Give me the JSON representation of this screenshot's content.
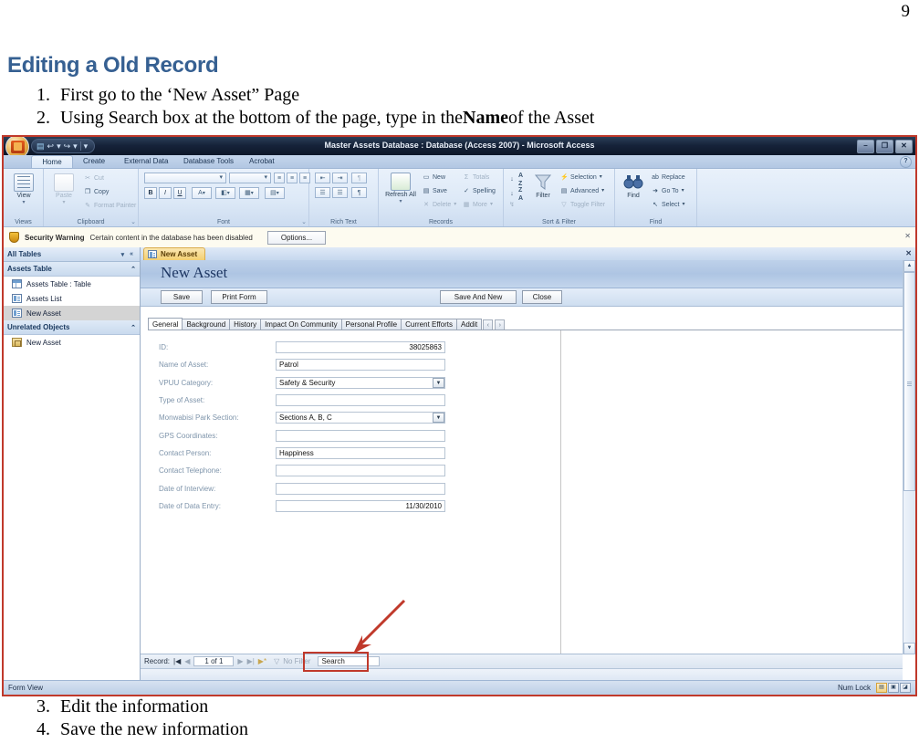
{
  "document": {
    "page_number": "9",
    "heading": "Editing a Old Record",
    "steps_top": [
      {
        "num": "1.",
        "text": "First go to the ‘New Asset” Page"
      },
      {
        "num": "2.",
        "text_before": "Using Search box at the bottom of the page, type in the ",
        "bold": "Name",
        "text_after": " of the Asset"
      }
    ],
    "steps_bottom": [
      {
        "num": "3.",
        "text": "Edit the information"
      },
      {
        "num": "4.",
        "text": "Save the new information"
      }
    ]
  },
  "access": {
    "titlebar": {
      "title": "Master Assets Database : Database (Access 2007) - Microsoft Access",
      "office_button": "office-button",
      "quick_access": [
        "save-icon",
        "undo-icon",
        "redo-icon",
        "customize-icon"
      ],
      "window_buttons": {
        "minimize": "–",
        "restore": "❐",
        "close": "✕"
      }
    },
    "ribbon": {
      "tabs": [
        "Home",
        "Create",
        "External Data",
        "Database Tools",
        "Acrobat"
      ],
      "active_tab": "Home",
      "help": "?",
      "groups": [
        {
          "label": "Views",
          "big_button": "View"
        },
        {
          "label": "Clipboard",
          "big_button": "Paste",
          "items": [
            "Cut",
            "Copy",
            "Format Painter"
          ]
        },
        {
          "label": "Font",
          "items": [
            "B",
            "I",
            "U",
            "A",
            "Fill",
            "Gridlines",
            "Alternate Fill"
          ]
        },
        {
          "label": "Rich Text",
          "items": []
        },
        {
          "label": "Records",
          "big_button": "Refresh All",
          "items": [
            "New",
            "Save",
            "Delete",
            "Totals",
            "Spelling",
            "More"
          ]
        },
        {
          "label": "Sort & Filter",
          "big_button": "Filter",
          "items": [
            "Selection",
            "Advanced",
            "Toggle Filter"
          ]
        },
        {
          "label": "Find",
          "big_button": "Find",
          "items": [
            "Replace",
            "Go To",
            "Select"
          ]
        }
      ]
    },
    "security_bar": {
      "label": "Security Warning",
      "message": "Certain content in the database has been disabled",
      "options_button": "Options...",
      "close": "✕"
    },
    "nav_pane": {
      "header": "All Tables",
      "groups": [
        {
          "title": "Assets Table",
          "items": [
            {
              "label": "Assets Table : Table",
              "icon": "table-icon",
              "selected": false
            },
            {
              "label": "Assets List",
              "icon": "form-icon",
              "selected": false
            },
            {
              "label": "New Asset",
              "icon": "form-icon",
              "selected": true
            }
          ]
        },
        {
          "title": "Unrelated Objects",
          "items": [
            {
              "label": "New Asset",
              "icon": "module-icon",
              "selected": false
            }
          ]
        }
      ]
    },
    "document_tab": {
      "label": "New Asset",
      "close": "✕"
    },
    "form": {
      "title": "New Asset",
      "buttons_left": [
        "Save",
        "Print Form"
      ],
      "buttons_right": [
        "Save And New",
        "Close"
      ],
      "tabs": [
        "General",
        "Background",
        "History",
        "Impact On Community",
        "Personal Profile",
        "Current Efforts",
        "Addit"
      ],
      "active_tab": "General",
      "tab_nav": [
        "‹",
        "›"
      ],
      "fields": [
        {
          "label": "ID:",
          "value": "38025863",
          "type": "text",
          "align": "right"
        },
        {
          "label": "Name of Asset:",
          "value": "Patrol",
          "type": "text",
          "align": "left"
        },
        {
          "label": "VPUU Category:",
          "value": "Safety & Security",
          "type": "combo",
          "align": "left"
        },
        {
          "label": "Type of Asset:",
          "value": "",
          "type": "text",
          "align": "left"
        },
        {
          "label": "Monwabisi Park Section:",
          "value": "Sections A, B, C",
          "type": "combo",
          "align": "left"
        },
        {
          "label": "GPS Coordinates:",
          "value": "",
          "type": "text",
          "align": "left"
        },
        {
          "label": "Contact Person:",
          "value": "Happiness",
          "type": "text",
          "align": "left"
        },
        {
          "label": "Contact Telephone:",
          "value": "",
          "type": "text",
          "align": "left"
        },
        {
          "label": "Date of Interview:",
          "value": "",
          "type": "text",
          "align": "left"
        },
        {
          "label": "Date of Data Entry:",
          "value": "11/30/2010",
          "type": "text",
          "align": "right"
        }
      ]
    },
    "record_nav": {
      "label": "Record:",
      "first": "|◀",
      "prev": "◀",
      "counter": "1 of 1",
      "next": "▶",
      "last": "▶|",
      "new_record": "▶*",
      "filter_status": "No Filter",
      "search_value": "Search"
    },
    "status_bar": {
      "view_mode": "Form View",
      "num_lock": "Num Lock",
      "view_buttons": [
        "form-view-icon",
        "layout-view-icon",
        "design-view-icon"
      ]
    }
  },
  "annotation": {
    "arrow_color": "#c0392b",
    "highlight_color": "#c0392b",
    "target": "search-box"
  }
}
